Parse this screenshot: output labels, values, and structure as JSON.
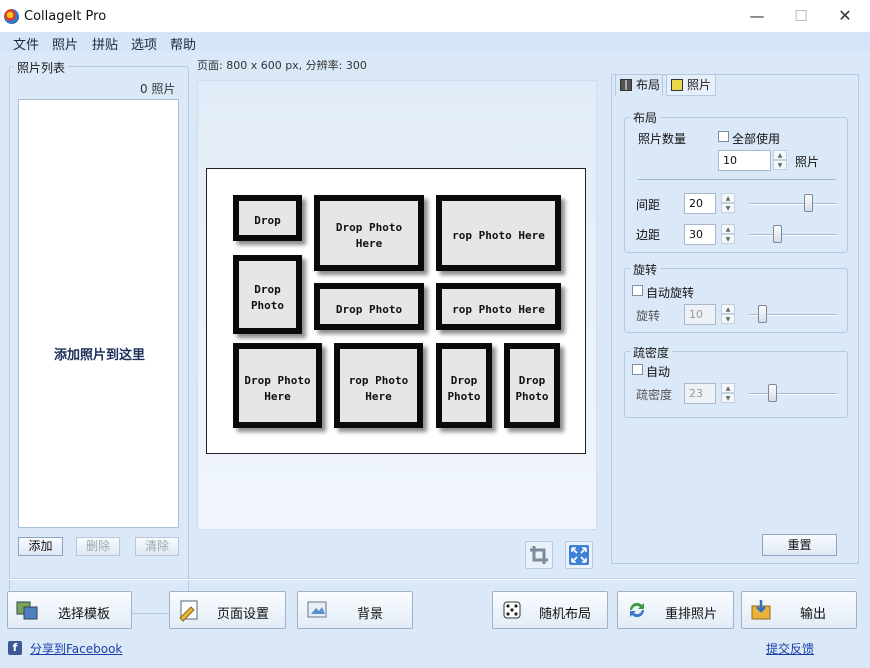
{
  "window": {
    "title": "CollageIt Pro",
    "minimize": "—",
    "maximize": "☐",
    "close": "✕"
  },
  "menu": [
    "文件",
    "照片",
    "拼贴",
    "选项",
    "帮助"
  ],
  "photo_list": {
    "title": "照片列表",
    "count": "0 照片",
    "drop_hint": "添加照片到这里",
    "add_label": "添加",
    "delete_label": "删除",
    "clear_label": "清除"
  },
  "canvas": {
    "page_info": "页面: 800 x 600 px, 分辨率: 300",
    "slots": [
      "Drop",
      "Drop Photo\nHere",
      "rop Photo Here",
      "Drop\nPhoto",
      "Drop Photo",
      "rop Photo Here",
      "Drop Photo\nHere",
      "rop Photo\nHere",
      "Drop\nPhoto",
      "Drop\nPhoto"
    ]
  },
  "right_panel": {
    "tab_layout": "布局",
    "tab_photo": "照片",
    "layout_group": {
      "title": "布局",
      "photo_count_label": "照片数量",
      "use_all_label": "全部使用",
      "photo_count_value": "10",
      "photo_count_unit": "照片",
      "spacing_label": "间距",
      "spacing_value": "20",
      "margin_label": "边距",
      "margin_value": "30"
    },
    "rotation_group": {
      "title": "旋转",
      "auto_rotate_label": "自动旋转",
      "rotate_label": "旋转",
      "rotate_value": "10"
    },
    "density_group": {
      "title": "疏密度",
      "auto_label": "自动",
      "density_label": "疏密度",
      "density_value": "23"
    },
    "reset_label": "重置"
  },
  "bottom_buttons": {
    "choose_template": "选择模板",
    "page_setup": "页面设置",
    "background": "背景",
    "random_layout": "随机布局",
    "reshuffle": "重排照片",
    "output": "输出"
  },
  "footer": {
    "share_facebook": "分享到Facebook",
    "feedback": "提交反馈"
  }
}
